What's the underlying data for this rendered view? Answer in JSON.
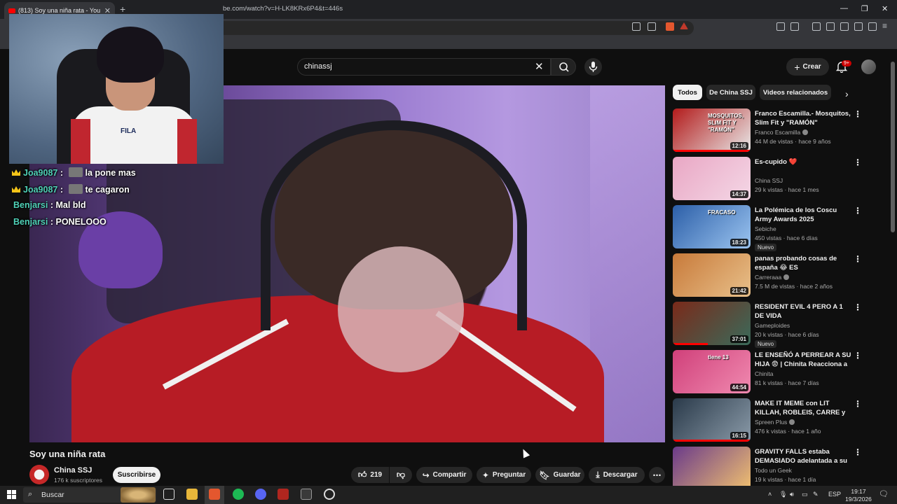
{
  "browser": {
    "tab_title": "(813) Soy una niña rata - You",
    "tab_close": "✕",
    "new_tab": "+",
    "url": "be.com/watch?v=H-LK8KRx6P4&t=446s",
    "window_controls": [
      "—",
      "❐",
      "✕"
    ]
  },
  "topbar": {
    "search_value": "chinassj",
    "clear_icon": "✕",
    "create_label": "Crear",
    "notifications_badge": "9+"
  },
  "chat": [
    {
      "user": "Joa9087",
      "sep": ":",
      "message": "la pone mas",
      "crown": true,
      "emote": true
    },
    {
      "user": "Joa9087",
      "sep": ":",
      "message": "te cagaron",
      "crown": true,
      "emote": true
    },
    {
      "user": "Benjarsi",
      "sep": ":",
      "message": "Mal bld",
      "crown": false,
      "emote": false
    },
    {
      "user": "Benjarsi",
      "sep": ":",
      "message": "PONELOOO",
      "crown": false,
      "emote": false
    }
  ],
  "webcam": {
    "shirt_logo": "FILA"
  },
  "video": {
    "title": "Soy una niña rata",
    "channel": "China SSJ",
    "subscribers": "176 k suscriptores",
    "subscribe_label": "Suscribirse",
    "likes": "219",
    "share_label": "Compartir",
    "ask_label": "Preguntar",
    "save_label": "Guardar",
    "download_label": "Descargar"
  },
  "sidebar": {
    "chips": [
      "Todos",
      "De China SSJ",
      "Videos relacionados"
    ],
    "items": [
      {
        "title": "Franco Escamilla.- Mosquitos, Slim Fit y \"RAMÓN\"",
        "channel": "Franco Escamilla",
        "verified": true,
        "meta": "44 M de vistas · hace 9 años",
        "duration": "12:16",
        "badge": "",
        "progress": 1.0,
        "thumb": [
          "#b31b1b",
          "#e8e8e8"
        ],
        "thumb_text": "MOSQUITOS, SLIM FIT Y \"RAMÓN\""
      },
      {
        "title": "Es-cupido ❤️",
        "channel": "China SSJ",
        "verified": false,
        "meta": "29 k vistas · hace 1 mes",
        "duration": "14:37",
        "badge": "",
        "progress": 0,
        "thumb": [
          "#e9a7c4",
          "#f4d7e6"
        ],
        "thumb_text": ""
      },
      {
        "title": "La Polémica de los Coscu Army Awards 2025",
        "channel": "Sebiche",
        "verified": false,
        "meta": "450 vistas · hace 6 días",
        "duration": "18:23",
        "badge": "Nuevo",
        "progress": 0,
        "thumb": [
          "#2c5fa8",
          "#9bc4f0"
        ],
        "thumb_text": "FRACASO"
      },
      {
        "title": "panas probando cosas de españa 😂 ES",
        "channel": "Carreraaa",
        "verified": true,
        "meta": "7.5 M de vistas · hace 2 años",
        "duration": "21:42",
        "badge": "",
        "progress": 0,
        "thumb": [
          "#c87a3a",
          "#e8c08a"
        ],
        "thumb_text": ""
      },
      {
        "title": "RESIDENT EVIL 4 PERO A 1 DE VIDA",
        "channel": "Gameploides",
        "verified": false,
        "meta": "20 k vistas · hace 6 días",
        "duration": "37:01",
        "badge": "Nuevo",
        "progress": 0.45,
        "thumb": [
          "#7a2a1a",
          "#3a6a5a"
        ],
        "thumb_text": ""
      },
      {
        "title": "LE ENSEÑÓ A PERREAR A SU HIJA 😨 | Chinita Reacciona a ...",
        "channel": "Chinita",
        "verified": false,
        "meta": "81 k vistas · hace 7 días",
        "duration": "44:54",
        "badge": "",
        "progress": 0,
        "thumb": [
          "#d0407a",
          "#f08ab0"
        ],
        "thumb_text": "tiene 13"
      },
      {
        "title": "MAKE IT MEME con LIT KILLAH, ROBLEIS, CARRE y GONCHO",
        "channel": "Spreen Plus",
        "verified": true,
        "meta": "476 k vistas · hace 1 año",
        "duration": "16:15",
        "badge": "",
        "progress": 1.0,
        "thumb": [
          "#2a3a4a",
          "#8a9aa8"
        ],
        "thumb_text": ""
      },
      {
        "title": "GRAVITY FALLS estaba DEMASIADO adelantada a su ...",
        "channel": "Todo un Geek",
        "verified": false,
        "meta": "19 k vistas · hace 1 día",
        "duration": "",
        "badge": "",
        "progress": 0,
        "thumb": [
          "#6a3a8a",
          "#f0c070"
        ],
        "thumb_text": ""
      }
    ]
  },
  "taskbar": {
    "search_label": "Buscar",
    "time": "19:17",
    "date": "19/3/2026",
    "lang": "ESP"
  },
  "colors": {
    "accent": "#ff0000",
    "chat_user": "#4fd1b7",
    "background": "#0f0f0f"
  }
}
